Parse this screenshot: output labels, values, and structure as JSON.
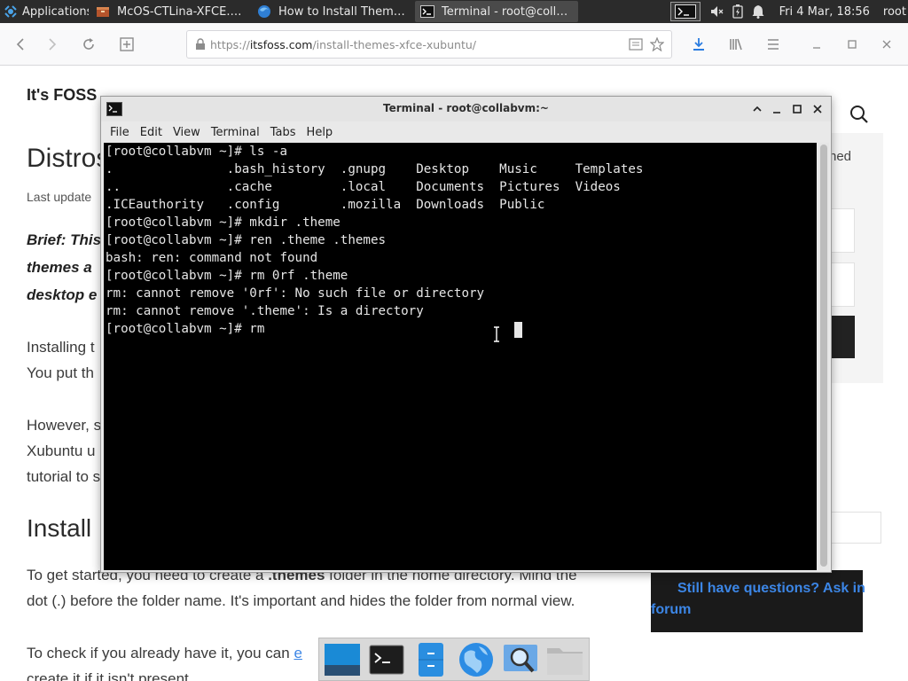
{
  "panel": {
    "apps_label": "Applications",
    "tasks": [
      {
        "label": "McOS-CTLina-XFCE.ta...",
        "icon": "archive-icon"
      },
      {
        "label": "How to Install Themes ...",
        "icon": "firefox-icon"
      },
      {
        "label": "Terminal - root@collabv...",
        "icon": "terminal-icon"
      }
    ],
    "clock": "Fri  4 Mar, 18:56",
    "user": "root"
  },
  "browser": {
    "url_prefix": "https://",
    "url_host": "itsfoss.com",
    "url_path": "/install-themes-xfce-xubuntu/"
  },
  "page": {
    "site_logo": "It's FOSS",
    "heading": "Distros",
    "last_updated": "Last update",
    "brief_1": "Brief: This",
    "brief_2": "themes a",
    "brief_3": "desktop e",
    "para1_1": "Installing t",
    "para1_2": "You put th",
    "para2_1": "However, s",
    "para2_2": "Xubuntu u",
    "para2_3": "tutorial to s",
    "h2": "Install",
    "para3_1_pre": "To get started, you need to create a ",
    "para3_1_bold": ".themes",
    "para3_1_post": " folder in the home directory. Mind the",
    "para3_2": "dot (.) before the folder name. It's important and hides the folder from normal view.",
    "para4_1_pre": "To check if you already have it, you can ",
    "para4_1_link": "e",
    "para4_2": "create it if it isn't present.",
    "sidebar_text": "ned",
    "cta_line1": "Still have questions? Ask in",
    "cta_line2": "forum"
  },
  "terminal": {
    "title": "Terminal - root@collabvm:~",
    "menu": [
      "File",
      "Edit",
      "View",
      "Terminal",
      "Tabs",
      "Help"
    ],
    "lines": [
      "[root@collabvm ~]# ls -a",
      ".               .bash_history  .gnupg    Desktop    Music     Templates",
      "..              .cache         .local    Documents  Pictures  Videos",
      ".ICEauthority   .config        .mozilla  Downloads  Public",
      "[root@collabvm ~]# mkdir .theme",
      "[root@collabvm ~]# ren .theme .themes",
      "bash: ren: command not found",
      "[root@collabvm ~]# rm 0rf .theme",
      "rm: cannot remove '0rf': No such file or directory",
      "rm: cannot remove '.theme': Is a directory"
    ],
    "current_prompt": "[root@collabvm ~]# rm"
  },
  "dock": {
    "items": [
      "desktop-icon",
      "terminal-icon",
      "file-manager-icon",
      "web-browser-icon",
      "app-finder-icon",
      "folder-icon"
    ]
  },
  "colors": {
    "panel_bg": "#2b2b2b",
    "terminal_bg": "#000000",
    "terminal_fg": "#e6e6e6",
    "link_blue": "#3c86e6"
  }
}
